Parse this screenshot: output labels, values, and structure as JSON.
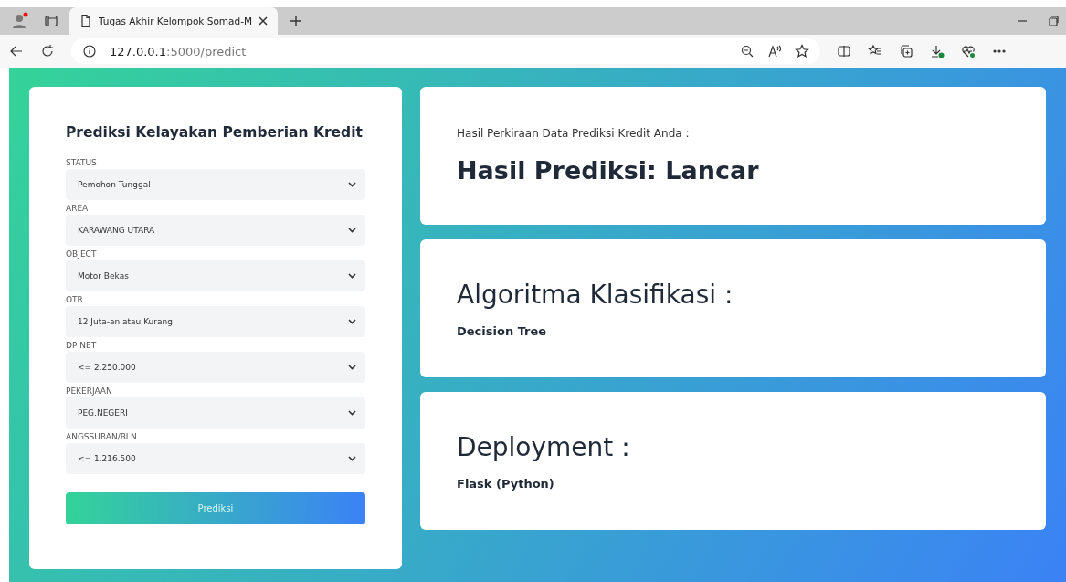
{
  "browser": {
    "tab_title": "Tugas Akhir Kelompok Somad-M",
    "url_host": "127.0.0.1",
    "url_path": ":5000/predict"
  },
  "form": {
    "title": "Prediksi Kelayakan Pemberian Kredit",
    "fields": [
      {
        "label": "STATUS",
        "value": "Pemohon Tunggal"
      },
      {
        "label": "AREA",
        "value": "KARAWANG UTARA"
      },
      {
        "label": "OBJECT",
        "value": "Motor Bekas"
      },
      {
        "label": "OTR",
        "value": "12 Juta-an atau Kurang"
      },
      {
        "label": "DP NET",
        "value": "<= 2.250.000"
      },
      {
        "label": "PEKERJAAN",
        "value": "PEG.NEGERI"
      },
      {
        "label": "ANGSSURAN/BLN",
        "value": "<= 1.216.500"
      }
    ],
    "button": "Prediksi"
  },
  "cards": [
    {
      "kind": "result",
      "caption": "Hasil Perkiraan Data Prediksi Kredit Anda :",
      "heading": "Hasil Prediksi: Lancar"
    },
    {
      "kind": "info",
      "heading": "Algoritma Klasifikasi :",
      "caption": "Decision Tree"
    },
    {
      "kind": "info",
      "heading": "Deployment :",
      "caption": "Flask (Python)"
    }
  ]
}
